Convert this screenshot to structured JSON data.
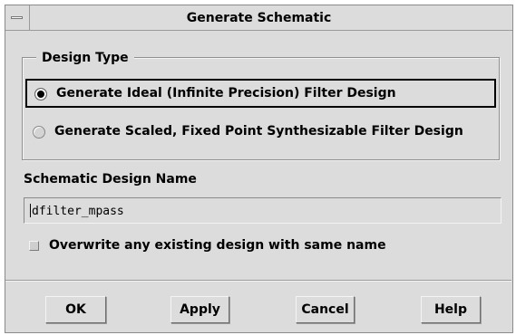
{
  "dialog": {
    "title": "Generate Schematic"
  },
  "design_type": {
    "group_label": "Design Type",
    "options": [
      {
        "label": "Generate Ideal (Infinite Precision) Filter Design",
        "selected": true
      },
      {
        "label": "Generate Scaled, Fixed Point Synthesizable Filter Design",
        "selected": false
      }
    ]
  },
  "schematic": {
    "label": "Schematic Design Name",
    "value": "dfilter_mpass"
  },
  "overwrite": {
    "label": "Overwrite any existing design with same name",
    "checked": false
  },
  "buttons": {
    "ok": "OK",
    "apply": "Apply",
    "cancel": "Cancel",
    "help": "Help"
  }
}
